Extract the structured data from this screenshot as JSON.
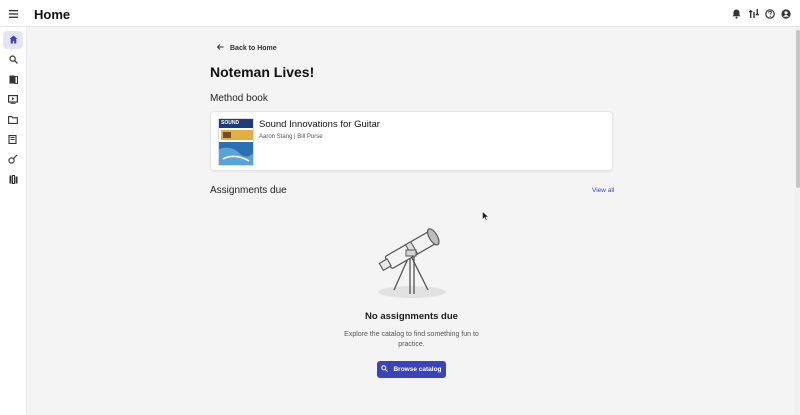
{
  "header": {
    "title": "Home",
    "icons": [
      "menu-icon",
      "bell-icon",
      "tuner-icon",
      "help-icon",
      "account-icon"
    ]
  },
  "sidebar": {
    "items": [
      {
        "name": "home-icon",
        "active": true
      },
      {
        "name": "search-icon",
        "active": false
      },
      {
        "name": "book-icon",
        "active": false
      },
      {
        "name": "video-icon",
        "active": false
      },
      {
        "name": "folder-icon",
        "active": false
      },
      {
        "name": "method-book-icon",
        "active": false
      },
      {
        "name": "guitar-icon",
        "active": false
      },
      {
        "name": "library-icon",
        "active": false
      }
    ]
  },
  "main": {
    "back_label": "Back to Home",
    "page_title": "Noteman Lives!",
    "method_book": {
      "section_title": "Method book",
      "book_title": "Sound Innovations for Guitar",
      "authors": "Aaron Stang | Bill Purse",
      "cover_label": "SOUND"
    },
    "assignments": {
      "section_title": "Assignments due",
      "view_all": "View all",
      "empty_title": "No assignments due",
      "empty_text": "Explore the catalog to find something fun to practice.",
      "browse_label": "Browse catalog"
    }
  },
  "colors": {
    "accent": "#3b43b8",
    "active_nav_bg": "#e3e5f6",
    "page_bg": "#f4f4f4"
  }
}
